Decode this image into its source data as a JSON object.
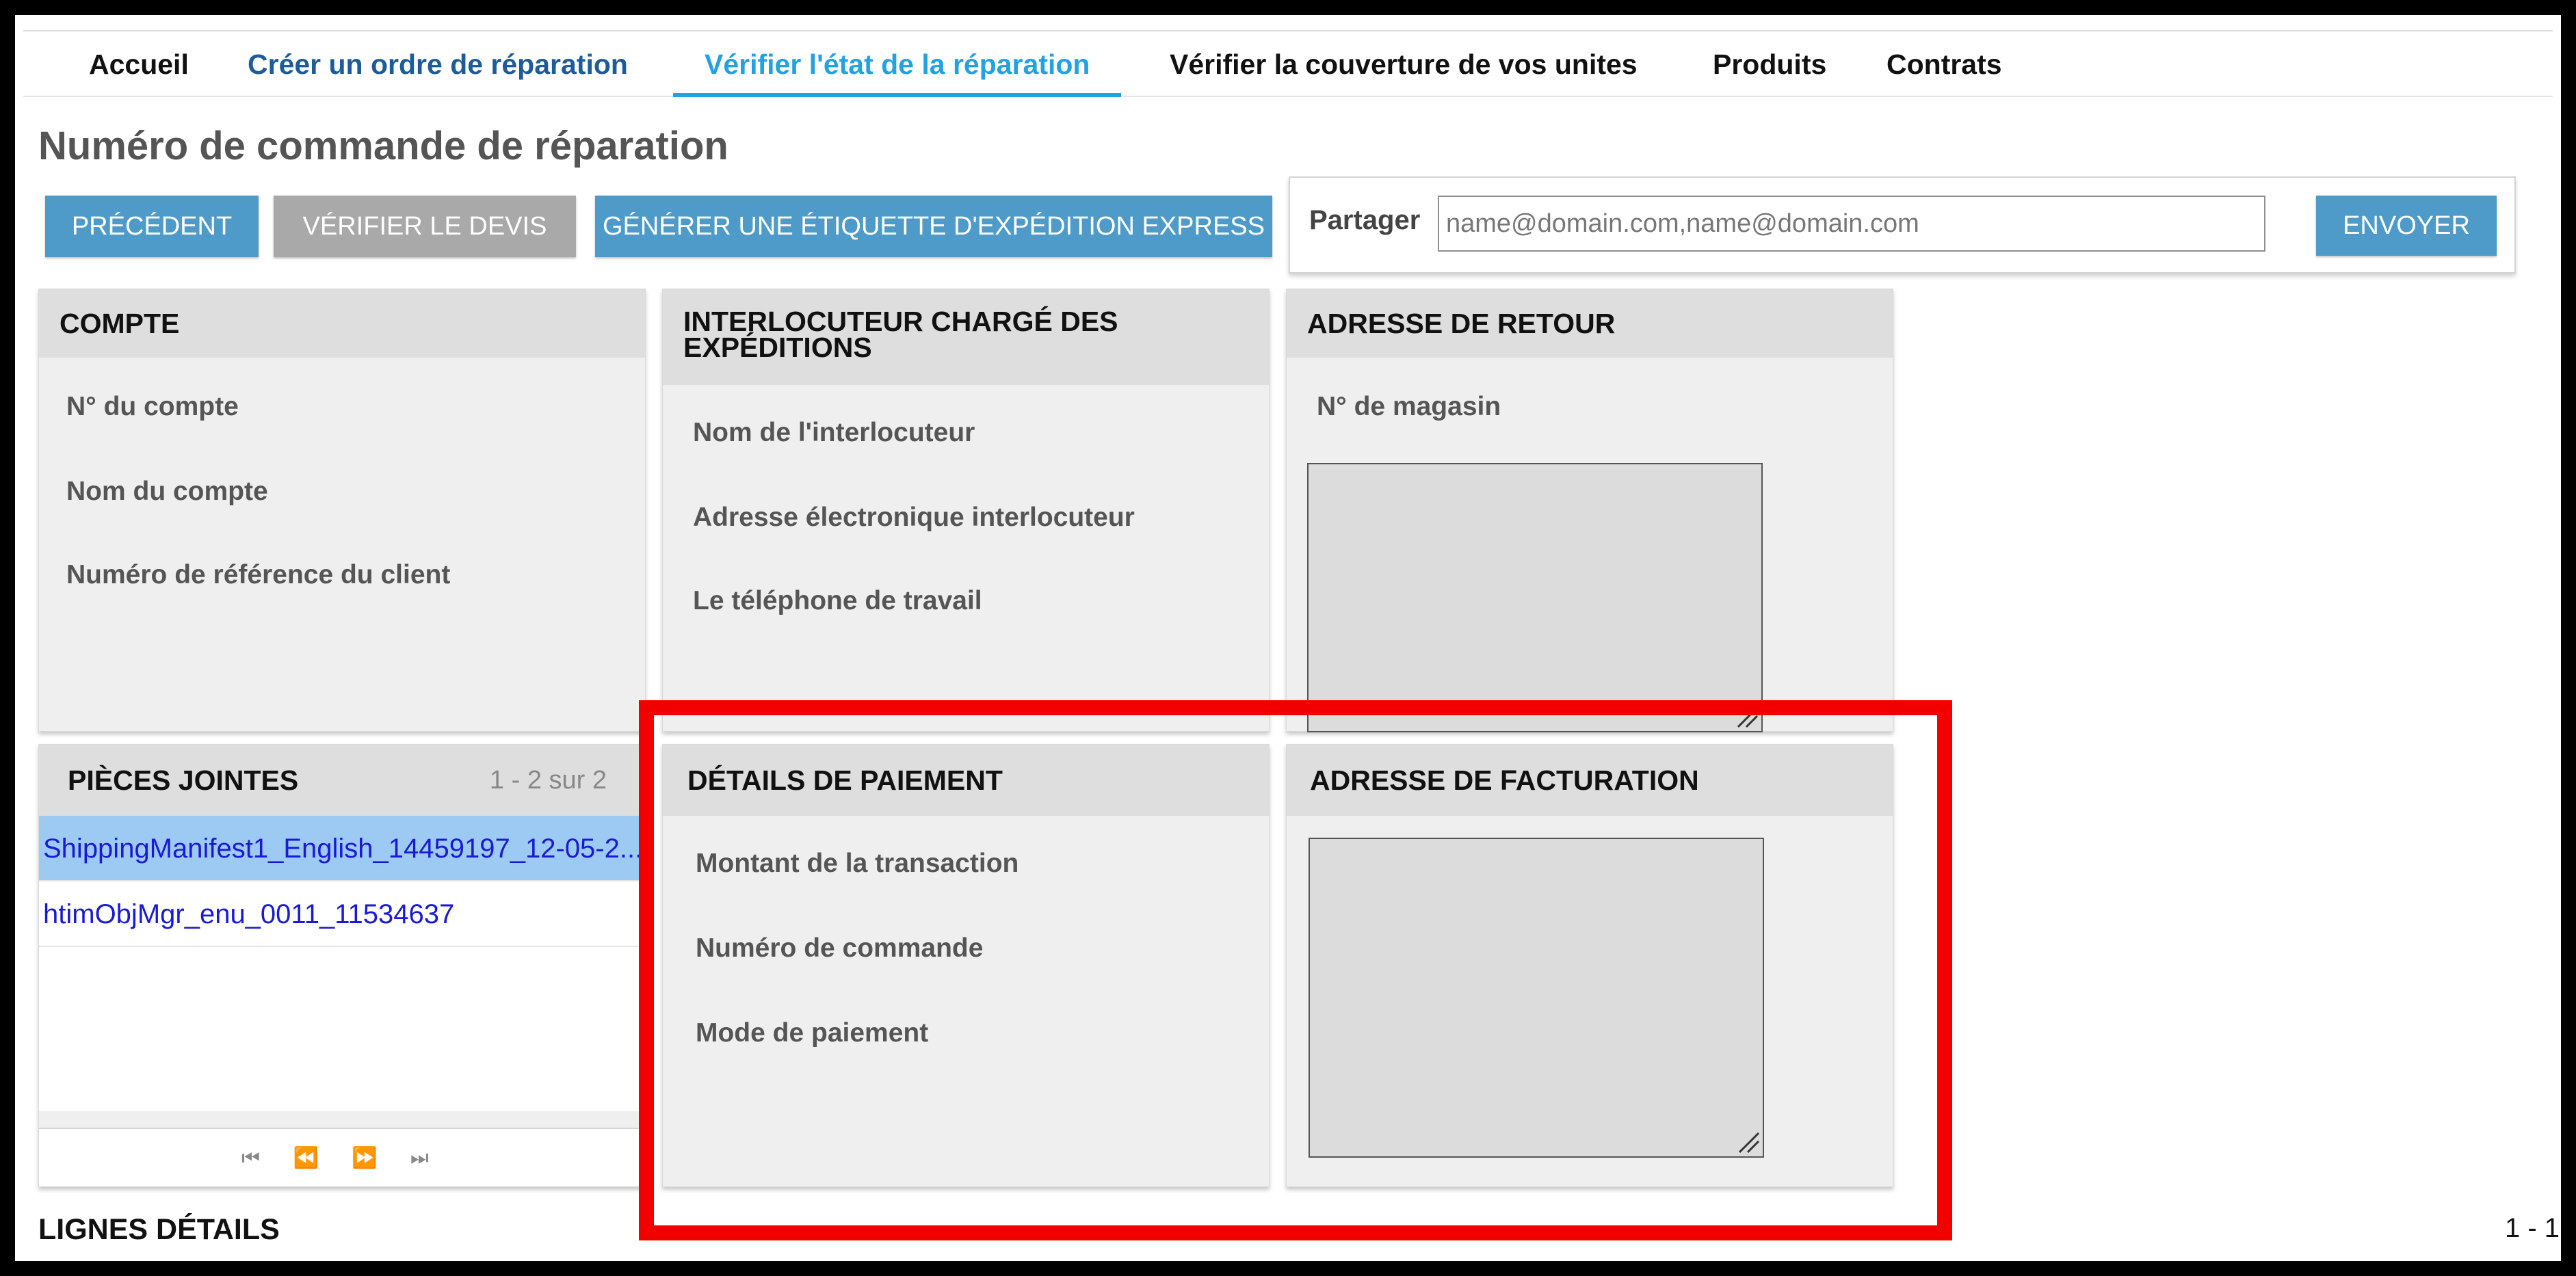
{
  "nav": {
    "tabs": [
      {
        "label": "Accueil"
      },
      {
        "label": "Créer un ordre de réparation"
      },
      {
        "label": "Vérifier l'état de la réparation"
      },
      {
        "label": "Vérifier la couverture de vos unites"
      },
      {
        "label": "Produits"
      },
      {
        "label": "Contrats"
      }
    ],
    "active_tab": "Vérifier l'état de la réparation"
  },
  "page": {
    "title": "Numéro de commande de réparation"
  },
  "toolbar": {
    "previous_label": "PRÉCÉDENT",
    "verify_quote_label": "VÉRIFIER LE DEVIS",
    "express_label": "GÉNÉRER UNE ÉTIQUETTE D'EXPÉDITION EXPRESS"
  },
  "share": {
    "label": "Partager",
    "placeholder": "name@domain.com,name@domain.com",
    "send_label": "ENVOYER"
  },
  "account": {
    "title": "COMPTE",
    "fields": [
      "N° du compte",
      "Nom du compte",
      "Numéro de référence du client"
    ]
  },
  "shipping_contact": {
    "title_line1": "INTERLOCUTEUR CHARGÉ DES",
    "title_line2": "EXPÉDITIONS",
    "fields": [
      "Nom de l'interlocuteur",
      "Adresse électronique interlocuteur",
      "Le téléphone de travail"
    ]
  },
  "return_address": {
    "title": "ADRESSE DE RETOUR",
    "store_label": "N° de magasin"
  },
  "attachments": {
    "title": "PIÈCES JOINTES",
    "count": "1 - 2 sur 2",
    "items": [
      "ShippingManifest1_English_14459197_12-05-2...",
      "htimObjMgr_enu_0011_11534637"
    ],
    "pager": "⏮ ⏪ ⏩ ⏭"
  },
  "payment": {
    "title": "DÉTAILS DE PAIEMENT",
    "fields": [
      "Montant de la transaction",
      "Numéro de commande",
      "Mode de paiement"
    ]
  },
  "billing_address": {
    "title": "ADRESSE DE FACTURATION"
  },
  "lines": {
    "title": "LIGNES DÉTAILS",
    "count": "1 - 1"
  },
  "colors": {
    "accent": "#23a2e2",
    "button": "#4e9bc9",
    "button_disabled": "#a9a9a9",
    "highlight": "#f20000",
    "link": "#1a1ad6",
    "selected_row": "#9ccaf2"
  }
}
